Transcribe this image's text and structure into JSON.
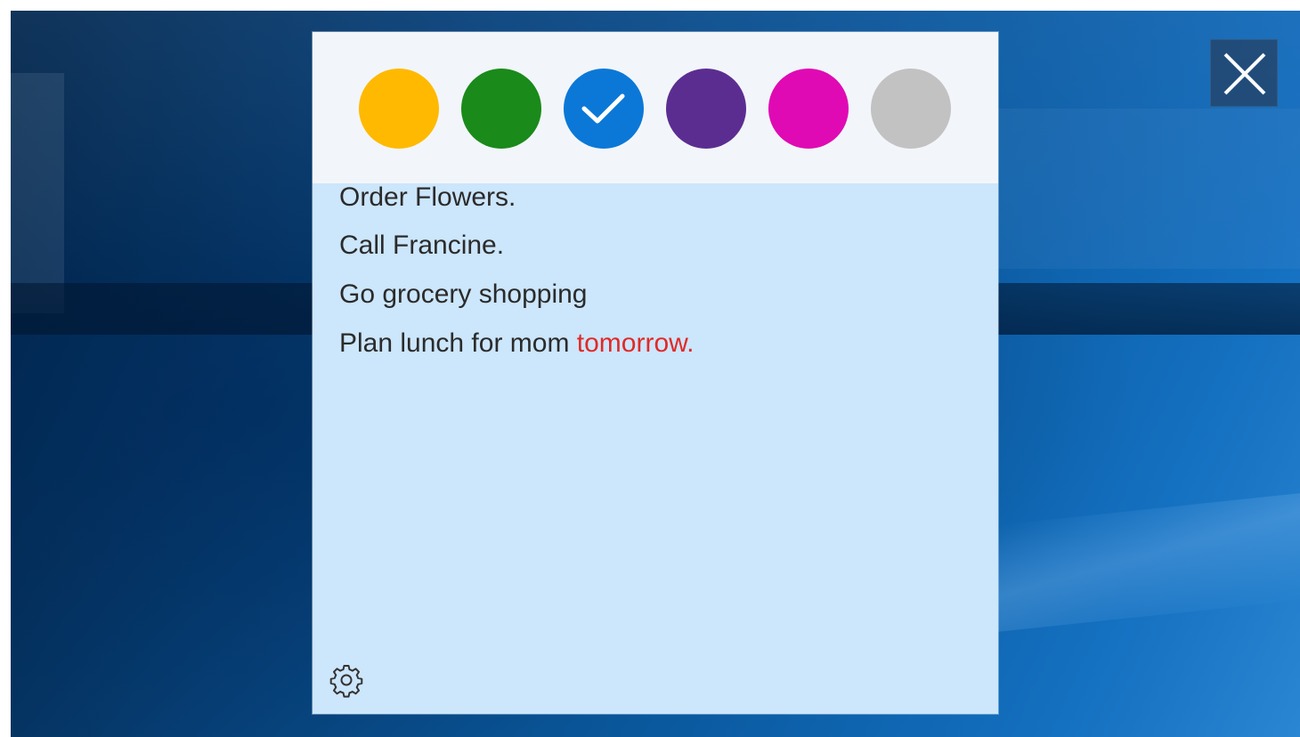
{
  "desktop": {
    "close_icon": "close-icon"
  },
  "note": {
    "background_color": "#cce6fb",
    "colors": [
      {
        "name": "yellow",
        "hex": "#ffb900",
        "selected": false
      },
      {
        "name": "green",
        "hex": "#1a8a1a",
        "selected": false
      },
      {
        "name": "blue",
        "hex": "#0b78d7",
        "selected": true
      },
      {
        "name": "purple",
        "hex": "#5c2d91",
        "selected": false
      },
      {
        "name": "pink",
        "hex": "#e00ab4",
        "selected": false
      },
      {
        "name": "gray",
        "hex": "#c2c2c2",
        "selected": false
      }
    ],
    "selected_icon": "checkmark-icon",
    "lines": [
      {
        "text": "Order Flowers."
      },
      {
        "text": "Call Francine."
      },
      {
        "text": "Go grocery shopping"
      },
      {
        "plain": "Plan lunch for mom ",
        "highlight": "tomorrow",
        "suffix": "."
      }
    ],
    "highlight_color": "#e02a27",
    "settings_icon": "gear-icon"
  }
}
